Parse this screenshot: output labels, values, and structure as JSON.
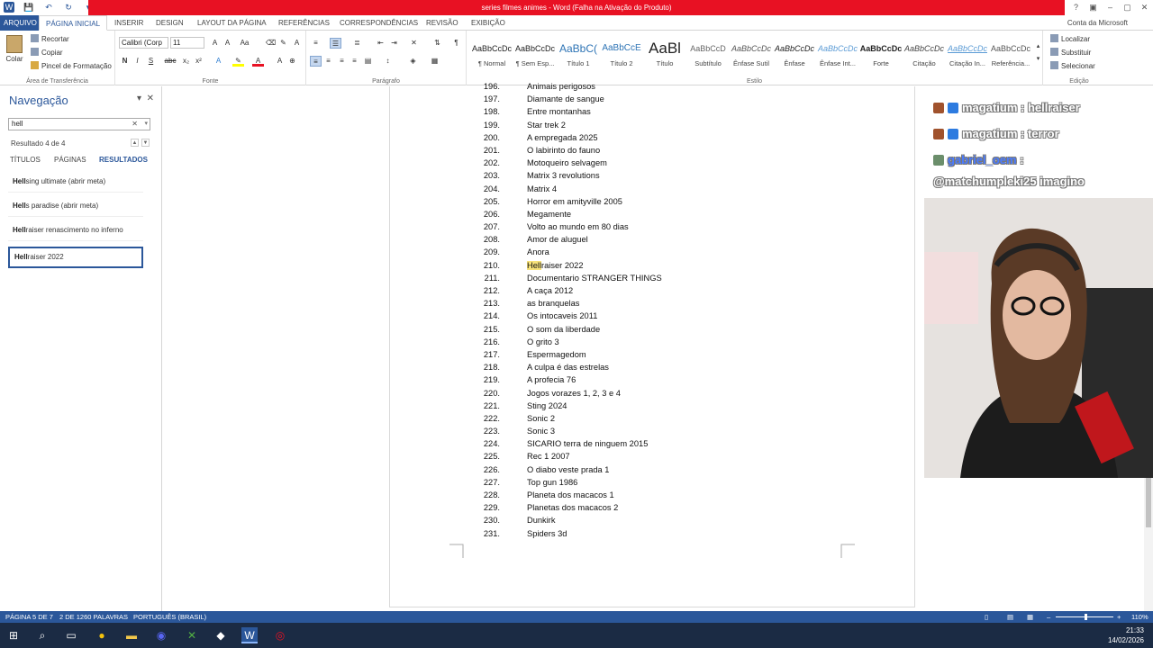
{
  "titlebar": {
    "title": "series filmes animes - Word (Falha na Ativação do Produto)",
    "quick_access": [
      "W",
      "💾",
      "↶",
      "↻",
      "▾"
    ],
    "window_controls": [
      "?",
      "▣",
      "–",
      "▢",
      "✕"
    ]
  },
  "ribbon_tabs": {
    "file": "ARQUIVO",
    "tabs": [
      "PÁGINA INICIAL",
      "INSERIR",
      "DESIGN",
      "LAYOUT DA PÁGINA",
      "REFERÊNCIAS",
      "CORRESPONDÊNCIAS",
      "REVISÃO",
      "EXIBIÇÃO"
    ],
    "account": "Conta da Microsoft"
  },
  "ribbon": {
    "clipboard": {
      "paste": "Colar",
      "cut": "Recortar",
      "copy": "Copiar",
      "format_painter": "Pincel de Formatação",
      "label": "Área de Transferência"
    },
    "font": {
      "name": "Calibri (Corp",
      "size": "11",
      "label": "Fonte",
      "buttons": [
        "N",
        "I",
        "S",
        "abc",
        "x₂",
        "x²"
      ]
    },
    "paragraph": {
      "label": "Parágrafo"
    },
    "styles": {
      "label": "Estilo",
      "items": [
        {
          "preview": "AaBbCcDc",
          "name": "¶ Normal"
        },
        {
          "preview": "AaBbCcDc",
          "name": "¶ Sem Esp..."
        },
        {
          "preview": "AaBbC(",
          "name": "Título 1"
        },
        {
          "preview": "AaBbCcE",
          "name": "Título 2"
        },
        {
          "preview": "AaBl",
          "name": "Título"
        },
        {
          "preview": "AaBbCcD",
          "name": "Subtítulo"
        },
        {
          "preview": "AaBbCcDc",
          "name": "Ênfase Sutil"
        },
        {
          "preview": "AaBbCcDc",
          "name": "Ênfase"
        },
        {
          "preview": "AaBbCcDc",
          "name": "Ênfase Int..."
        },
        {
          "preview": "AaBbCcDc",
          "name": "Forte"
        },
        {
          "preview": "AaBbCcDc",
          "name": "Citação"
        },
        {
          "preview": "AaBbCcDc",
          "name": "Citação In..."
        },
        {
          "preview": "AaBbCcDc",
          "name": "Referência..."
        }
      ]
    },
    "editing": {
      "find": "Localizar",
      "replace": "Substituir",
      "select": "Selecionar",
      "label": "Edição"
    }
  },
  "nav": {
    "title": "Navegação",
    "search_value": "hell",
    "result_text": "Resultado 4 de 4",
    "tabs": [
      "TÍTULOS",
      "PÁGINAS",
      "RESULTADOS"
    ],
    "results": [
      {
        "match": "Hell",
        "rest": "sing ultimate (abrir meta)"
      },
      {
        "match": "Hell",
        "rest": "s paradise (abrir meta)"
      },
      {
        "match": "Hell",
        "rest": "raiser renascimento no inferno"
      },
      {
        "match": "Hell",
        "rest": "raiser 2022"
      }
    ]
  },
  "document": {
    "items": [
      {
        "n": "196.",
        "t": "Animais perigosos"
      },
      {
        "n": "197.",
        "t": "Diamante de sangue"
      },
      {
        "n": "198.",
        "t": "Entre montanhas"
      },
      {
        "n": "199.",
        "t": "Star trek 2"
      },
      {
        "n": "200.",
        "t": "A empregada 2025"
      },
      {
        "n": "201.",
        "t": "O labirinto do fauno"
      },
      {
        "n": "202.",
        "t": "Motoqueiro selvagem"
      },
      {
        "n": "203.",
        "t": "Matrix 3 revolutions"
      },
      {
        "n": "204.",
        "t": "Matrix 4"
      },
      {
        "n": "205.",
        "t": "Horror em amityville 2005"
      },
      {
        "n": "206.",
        "t": "Megamente"
      },
      {
        "n": "207.",
        "t": "Volto ao mundo em 80 dias"
      },
      {
        "n": "208.",
        "t": "Amor de aluguel"
      },
      {
        "n": "209.",
        "t": "Anora"
      },
      {
        "n": "210.",
        "t": "raiser 2022",
        "hl": "Hell"
      },
      {
        "n": "211.",
        "t": "Documentario STRANGER THINGS"
      },
      {
        "n": "212.",
        "t": "A caça 2012"
      },
      {
        "n": "213.",
        "t": "as branquelas"
      },
      {
        "n": "214.",
        "t": "Os intocaveis 2011"
      },
      {
        "n": "215.",
        "t": "O som da liberdade"
      },
      {
        "n": "216.",
        "t": "O grito 3"
      },
      {
        "n": "217.",
        "t": "Espermagedom"
      },
      {
        "n": "218.",
        "t": "A culpa é das estrelas"
      },
      {
        "n": "219.",
        "t": "A profecia 76"
      },
      {
        "n": "220.",
        "t": "Jogos vorazes 1, 2, 3 e 4"
      },
      {
        "n": "221.",
        "t": "Sting 2024"
      },
      {
        "n": "222.",
        "t": "Sonic 2"
      },
      {
        "n": "223.",
        "t": "Sonic 3"
      },
      {
        "n": "224.",
        "t": "SICARIO terra de ninguem 2015"
      },
      {
        "n": "225.",
        "t": "Rec 1 2007"
      },
      {
        "n": "226.",
        "t": "O diabo veste prada 1"
      },
      {
        "n": "227.",
        "t": "Top gun 1986"
      },
      {
        "n": "228.",
        "t": "Planeta dos macacos 1"
      },
      {
        "n": "229.",
        "t": "Planetas dos macacos 2"
      },
      {
        "n": "230.",
        "t": "Dunkirk"
      },
      {
        "n": "231.",
        "t": "Spiders 3d"
      }
    ]
  },
  "chat": {
    "messages": [
      {
        "user": "magatium",
        "text": ": hellraiser"
      },
      {
        "user": "magatium",
        "text": ": terror"
      },
      {
        "user": "gabriel_oem",
        "text": ":"
      },
      {
        "user": "",
        "text": "@matchumpleki25 imagino"
      }
    ]
  },
  "status": {
    "page": "PÁGINA 5 DE 7",
    "words": "2 DE 1260 PALAVRAS",
    "language": "PORTUGUÊS (BRASIL)",
    "zoom": "110%"
  },
  "taskbar": {
    "time": "21:33",
    "date": "14/02/2026"
  },
  "colors": {
    "word_blue": "#2b579a",
    "title_red": "#e81123",
    "highlight": "#f7e27a"
  }
}
